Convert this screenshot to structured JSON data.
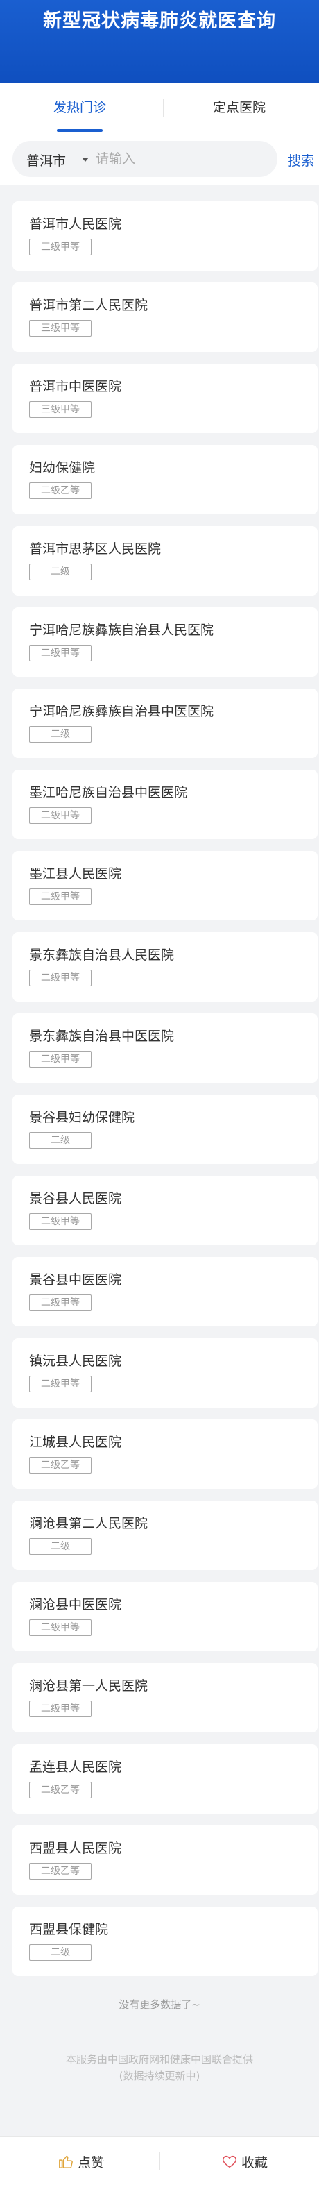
{
  "header": {
    "title": "新型冠状病毒肺炎就医查询"
  },
  "tabs": [
    {
      "label": "发热门诊",
      "active": true
    },
    {
      "label": "定点医院",
      "active": false
    }
  ],
  "search": {
    "city": "普洱市",
    "placeholder": "请输入",
    "value": "",
    "button": "搜索"
  },
  "hospitals": [
    {
      "name": "普洱市人民医院",
      "level": "三级甲等"
    },
    {
      "name": "普洱市第二人民医院",
      "level": "三级甲等"
    },
    {
      "name": "普洱市中医医院",
      "level": "三级甲等"
    },
    {
      "name": "妇幼保健院",
      "level": "二级乙等"
    },
    {
      "name": "普洱市思茅区人民医院",
      "level": "二级"
    },
    {
      "name": "宁洱哈尼族彝族自治县人民医院",
      "level": "二级甲等"
    },
    {
      "name": "宁洱哈尼族彝族自治县中医医院",
      "level": "二级"
    },
    {
      "name": "墨江哈尼族自治县中医医院",
      "level": "二级甲等"
    },
    {
      "name": "墨江县人民医院",
      "level": "二级甲等"
    },
    {
      "name": "景东彝族自治县人民医院",
      "level": "二级甲等"
    },
    {
      "name": "景东彝族自治县中医医院",
      "level": "二级甲等"
    },
    {
      "name": "景谷县妇幼保健院",
      "level": "二级"
    },
    {
      "name": "景谷县人民医院",
      "level": "二级甲等"
    },
    {
      "name": "景谷县中医医院",
      "level": "二级甲等"
    },
    {
      "name": "镇沅县人民医院",
      "level": "二级甲等"
    },
    {
      "name": "江城县人民医院",
      "level": "二级乙等"
    },
    {
      "name": "澜沧县第二人民医院",
      "level": "二级"
    },
    {
      "name": "澜沧县中医医院",
      "level": "二级甲等"
    },
    {
      "name": "澜沧县第一人民医院",
      "level": "二级甲等"
    },
    {
      "name": "孟连县人民医院",
      "level": "二级乙等"
    },
    {
      "name": "西盟县人民医院",
      "level": "二级乙等"
    },
    {
      "name": "西盟县保健院",
      "level": "二级"
    }
  ],
  "list_end": {
    "text": "没有更多数据了~"
  },
  "footer_note": {
    "line1": "本服务由中国政府网和健康中国联合提供",
    "line2": "(数据持续更新中)"
  },
  "bottom_bar": {
    "like_label": "点赞",
    "like_icon": "thumbs-up-icon",
    "favorite_label": "收藏",
    "favorite_icon": "heart-icon",
    "like_icon_color": "#e0a53a",
    "favorite_icon_color": "#e0505a"
  },
  "colors": {
    "primary": "#1a5fd0",
    "background": "#f2f3f5"
  }
}
